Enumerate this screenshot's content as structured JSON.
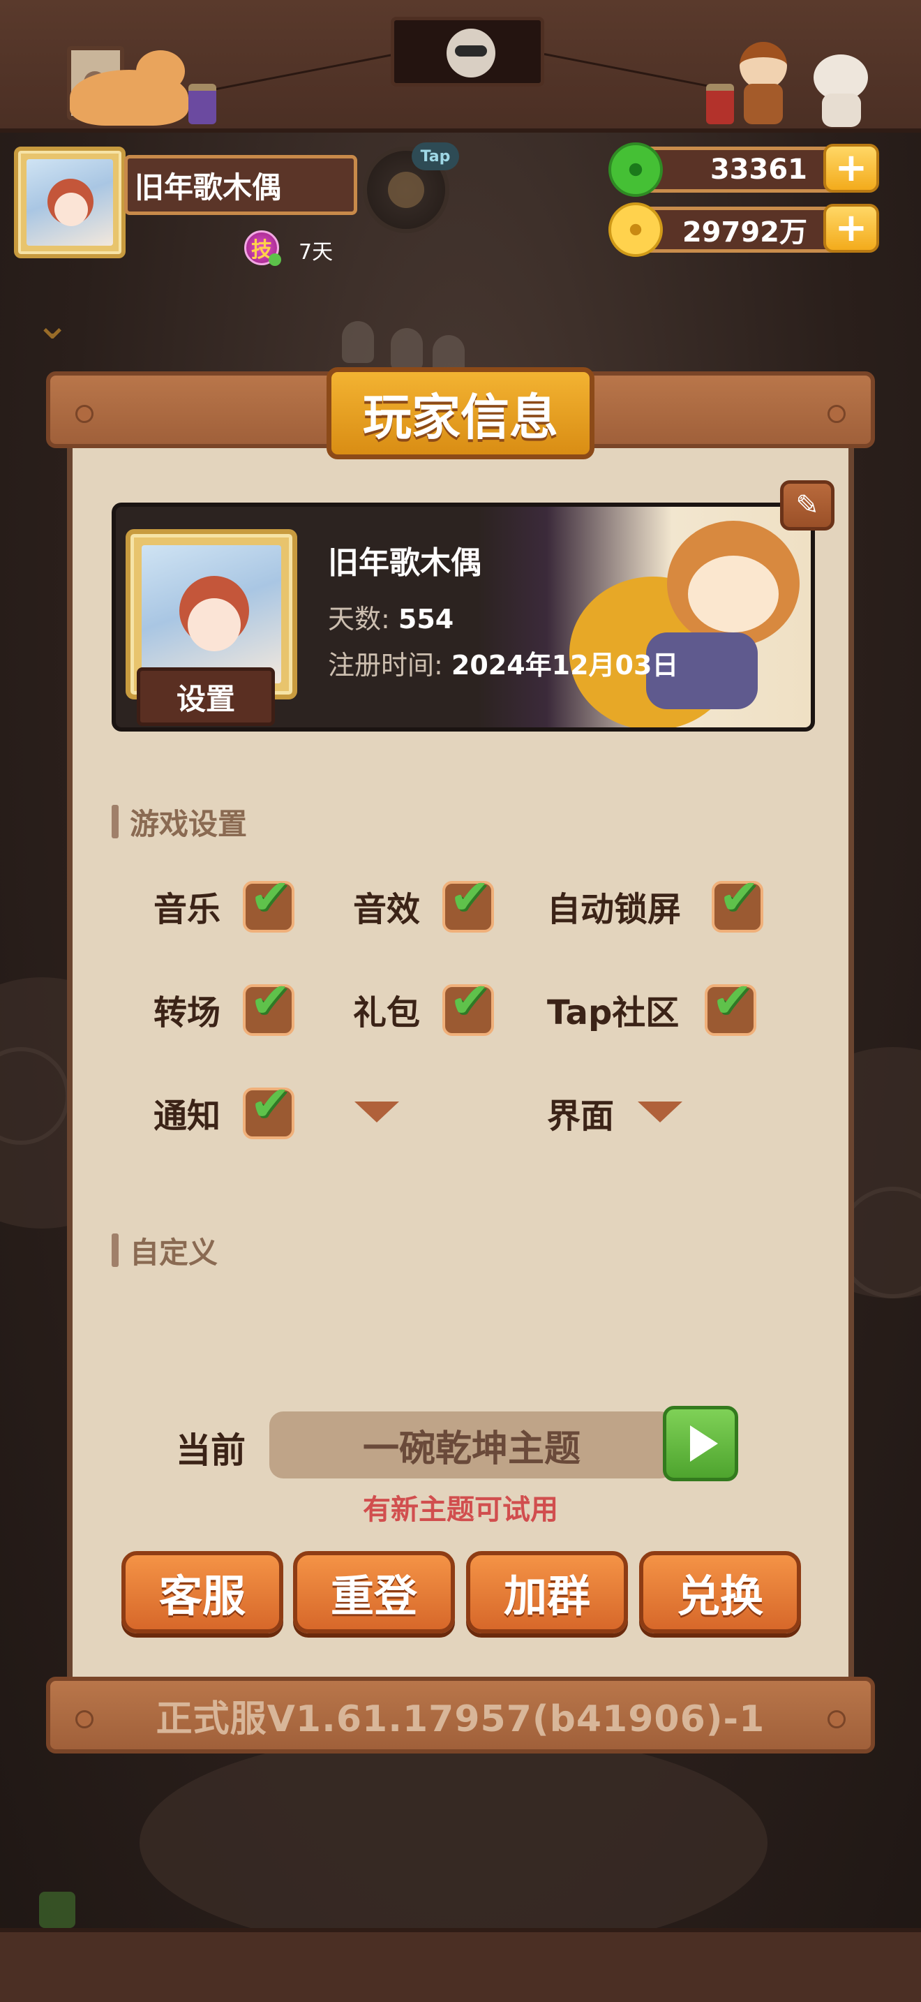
{
  "header": {
    "player_name": "旧年歌木偶",
    "skill_badge": "技",
    "days_short": "7天",
    "tap_badge": "Tap",
    "jade_amount": "33361",
    "gold_amount": "29792万",
    "plus_symbol": "+"
  },
  "modal": {
    "title": "玩家信息",
    "profile": {
      "name": "旧年歌木偶",
      "days_label": "天数:",
      "days_value": "554",
      "reg_label": "注册时间:",
      "reg_value": "2024年12月03日",
      "setting_button": "设置",
      "edit_icon": "✎"
    },
    "game_settings": {
      "header": "游戏设置",
      "music": "音乐",
      "sound": "音效",
      "auto_lock": "自动锁屏",
      "transition": "转场",
      "gift": "礼包",
      "tap_community": "Tap社区",
      "notify": "通知",
      "interface": "界面",
      "check_glyph": "✔"
    },
    "custom": {
      "header": "自定义",
      "current_label": "当前",
      "theme_value": "一碗乾坤主题",
      "new_theme_hint": "有新主题可试用"
    },
    "buttons": {
      "service": "客服",
      "relogin": "重登",
      "join_group": "加群",
      "redeem": "兑换"
    },
    "version": "正式服V1.61.17957(b41906)-1"
  },
  "colors": {
    "accent_orange": "#d7682a",
    "title_gold": "#f3b332",
    "check_green": "#5fc24b",
    "hint_red": "#d14e4e",
    "panel_bg": "#e3d4bd"
  },
  "icons": {
    "jade": "jade-coin-icon",
    "gold": "gold-coin-icon",
    "edit": "edit-icon",
    "play": "play-icon",
    "check": "check-icon",
    "dropdown": "chevron-down-icon"
  }
}
